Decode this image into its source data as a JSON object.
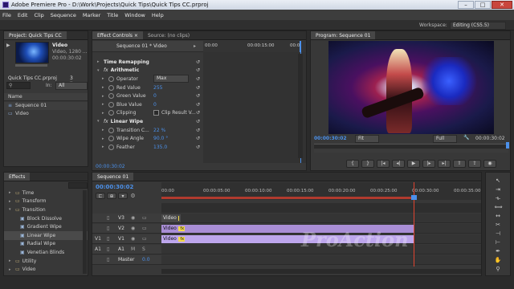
{
  "window": {
    "title": "Adobe Premiere Pro - D:\\Work\\Projects\\Quick Tips\\Quick Tips CC.prproj"
  },
  "menu": [
    "File",
    "Edit",
    "Clip",
    "Sequence",
    "Marker",
    "Title",
    "Window",
    "Help"
  ],
  "workspace": {
    "label": "Workspace:",
    "value": "Editing (CS5.5)"
  },
  "project": {
    "tab": "Project: Quick Tips CC",
    "clip_name": "Video",
    "clip_info": "Video, 1280 ...",
    "clip_info2": "00:00:30:02",
    "file": "Quick Tips CC.prproj",
    "items_count": "3 Items",
    "in_label": "In:",
    "in_value": "All",
    "col_name": "Name",
    "items": [
      "Sequence 01",
      "Video"
    ]
  },
  "effect_controls": {
    "tab": "Effect Controls",
    "tab_close": "×",
    "tab2": "Source: (no clips)",
    "path": "Sequence 01 * Video",
    "ruler": [
      "00:00",
      "00:00:15:00",
      "00:0"
    ],
    "rows": [
      {
        "label": "Time Remapping",
        "value": "",
        "type": "group"
      },
      {
        "label": "Arithmetic",
        "value": "",
        "type": "fx"
      },
      {
        "label": "Operator",
        "value": "Max",
        "type": "dropdown"
      },
      {
        "label": "Red Value",
        "value": "255",
        "type": "value"
      },
      {
        "label": "Green Value",
        "value": "0",
        "type": "value"
      },
      {
        "label": "Blue Value",
        "value": "0",
        "type": "value"
      },
      {
        "label": "Clipping",
        "value": "Clip Result V...",
        "type": "checkbox"
      },
      {
        "label": "Linear Wipe",
        "value": "",
        "type": "fx"
      },
      {
        "label": "Transition C...",
        "value": "22 %",
        "type": "value"
      },
      {
        "label": "Wipe Angle",
        "value": "90.0 °",
        "type": "value"
      },
      {
        "label": "Feather",
        "value": "135.0",
        "type": "value"
      }
    ],
    "timecode": "00:00:30:02"
  },
  "program": {
    "tab": "Program: Sequence 01",
    "timecode_left": "00:00:30:02",
    "fit": "Fit",
    "full": "Full",
    "timecode_right": "00:00:30:02",
    "ruler_right": "00:05:00:00"
  },
  "effects": {
    "tab": "Effects",
    "items": [
      {
        "label": "Time",
        "indent": 1,
        "kind": "folder"
      },
      {
        "label": "Transform",
        "indent": 1,
        "kind": "folder"
      },
      {
        "label": "Transition",
        "indent": 1,
        "kind": "folder-open"
      },
      {
        "label": "Block Dissolve",
        "indent": 2,
        "kind": "fx"
      },
      {
        "label": "Gradient Wipe",
        "indent": 2,
        "kind": "fx"
      },
      {
        "label": "Linear Wipe",
        "indent": 2,
        "kind": "fx"
      },
      {
        "label": "Radial Wipe",
        "indent": 2,
        "kind": "fx"
      },
      {
        "label": "Venetian Blinds",
        "indent": 2,
        "kind": "fx"
      },
      {
        "label": "Utility",
        "indent": 1,
        "kind": "folder"
      },
      {
        "label": "Video",
        "indent": 1,
        "kind": "folder"
      }
    ]
  },
  "timeline": {
    "tab": "Sequence 01",
    "timecode": "00:00:30:02",
    "ruler": [
      "00:00",
      "00:00:05:00",
      "00:00:10:00",
      "00:00:15:00",
      "00:00:20:00",
      "00:00:25:00",
      "00:00:30:00",
      "00:00:35:00"
    ],
    "tracks": [
      {
        "name": "V3",
        "src": "",
        "clip": "Video"
      },
      {
        "name": "V2",
        "src": "",
        "clip": "Video"
      },
      {
        "name": "V1",
        "src": "V1",
        "clip": "Video"
      },
      {
        "name": "A1",
        "src": "A1",
        "clip": ""
      },
      {
        "name": "Master",
        "src": "",
        "clip": "",
        "vol": "0.0"
      }
    ]
  },
  "watermark": "ProAction",
  "colors": {
    "accent": "#4b90ea",
    "clip_video": "#a98ed6",
    "clip_selected": "#bda6ec",
    "playhead": "#e0432f"
  }
}
